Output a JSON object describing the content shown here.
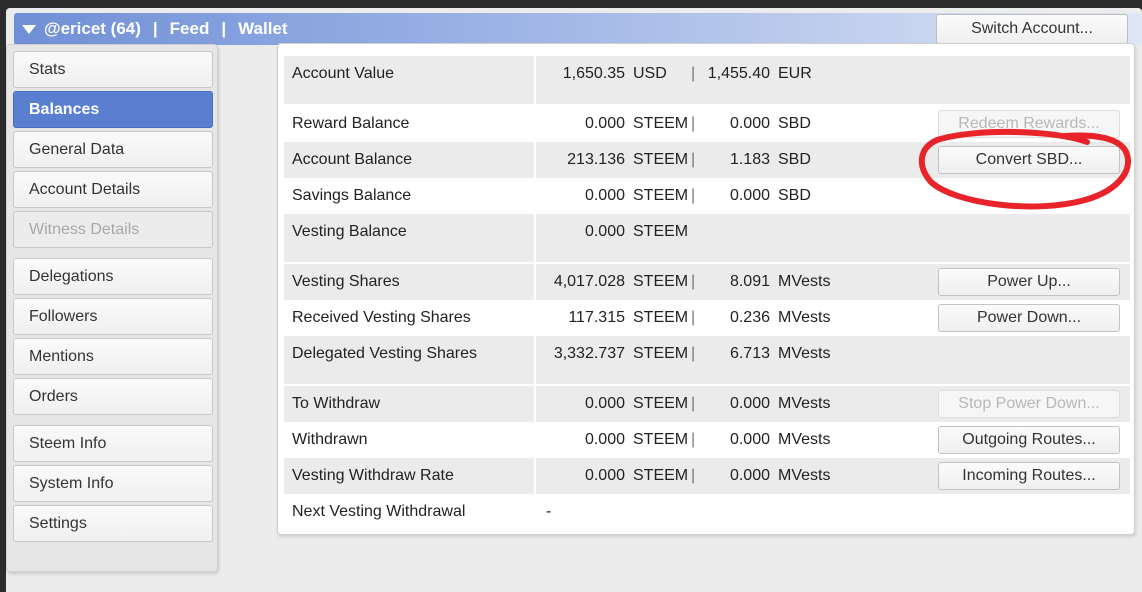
{
  "titlebar": {
    "account": "@ericet (64)",
    "separator": "|",
    "links": [
      "Feed",
      "Wallet"
    ],
    "switch_label": "Switch Account..."
  },
  "sidebar": {
    "groups": [
      [
        {
          "label": "Stats",
          "state": "normal"
        },
        {
          "label": "Balances",
          "state": "active"
        },
        {
          "label": "General Data",
          "state": "normal"
        },
        {
          "label": "Account Details",
          "state": "normal"
        },
        {
          "label": "Witness Details",
          "state": "disabled"
        }
      ],
      [
        {
          "label": "Delegations",
          "state": "normal"
        },
        {
          "label": "Followers",
          "state": "normal"
        },
        {
          "label": "Mentions",
          "state": "normal"
        },
        {
          "label": "Orders",
          "state": "normal"
        }
      ],
      [
        {
          "label": "Steem Info",
          "state": "normal"
        },
        {
          "label": "System Info",
          "state": "normal"
        },
        {
          "label": "Settings",
          "state": "normal"
        }
      ]
    ]
  },
  "balances": {
    "separator": "|",
    "sections": [
      [
        {
          "label": "Account Value",
          "v1": "1,650.35",
          "u1": "USD",
          "v2": "1,455.40",
          "u2": "EUR"
        }
      ],
      [
        {
          "label": "Reward Balance",
          "v1": "0.000",
          "u1": "STEEM",
          "v2": "0.000",
          "u2": "SBD",
          "button": "Redeem Rewards...",
          "button_disabled": true
        },
        {
          "label": "Account Balance",
          "v1": "213.136",
          "u1": "STEEM",
          "v2": "1.183",
          "u2": "SBD",
          "button": "Convert SBD...",
          "button_disabled": false
        },
        {
          "label": "Savings Balance",
          "v1": "0.000",
          "u1": "STEEM",
          "v2": "0.000",
          "u2": "SBD"
        },
        {
          "label": "Vesting Balance",
          "v1": "0.000",
          "u1": "STEEM"
        }
      ],
      [
        {
          "label": "Vesting Shares",
          "v1": "4,017.028",
          "u1": "STEEM",
          "v2": "8.091",
          "u2": "MVests",
          "button": "Power Up...",
          "button_disabled": false
        },
        {
          "label": "Received Vesting Shares",
          "v1": "117.315",
          "u1": "STEEM",
          "v2": "0.236",
          "u2": "MVests",
          "button": "Power Down...",
          "button_disabled": false
        },
        {
          "label": "Delegated Vesting Shares",
          "v1": "3,332.737",
          "u1": "STEEM",
          "v2": "6.713",
          "u2": "MVests"
        }
      ],
      [
        {
          "label": "To Withdraw",
          "v1": "0.000",
          "u1": "STEEM",
          "v2": "0.000",
          "u2": "MVests",
          "button": "Stop Power Down...",
          "button_disabled": true
        },
        {
          "label": "Withdrawn",
          "v1": "0.000",
          "u1": "STEEM",
          "v2": "0.000",
          "u2": "MVests",
          "button": "Outgoing Routes...",
          "button_disabled": false
        },
        {
          "label": "Vesting Withdraw Rate",
          "v1": "0.000",
          "u1": "STEEM",
          "v2": "0.000",
          "u2": "MVests",
          "button": "Incoming Routes...",
          "button_disabled": false
        },
        {
          "label": "Next Vesting Withdrawal",
          "dash": "-"
        }
      ]
    ]
  },
  "colors": {
    "active_nav": "#5a7fd1",
    "annotation": "#e8232a"
  }
}
